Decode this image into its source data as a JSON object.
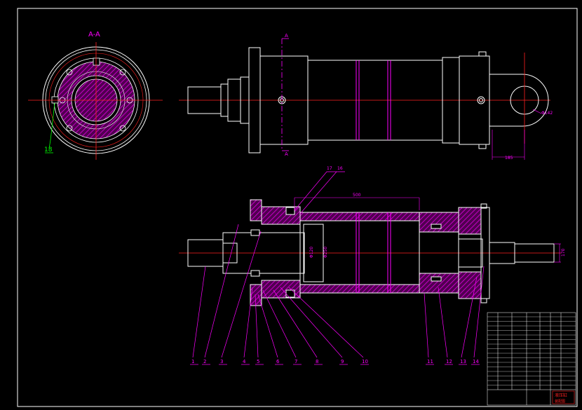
{
  "section": {
    "title": "A-A",
    "cut_mark_top": "A",
    "cut_mark_bottom": "A"
  },
  "dimensions": {
    "eye_diameter": "Φ142",
    "eye_offset": "185",
    "stroke": "500",
    "bore": "Φ250",
    "rod": "Φ120",
    "rod_end": "170"
  },
  "part_numbers": [
    "1",
    "2",
    "3",
    "4",
    "5",
    "6",
    "7",
    "8",
    "9",
    "10",
    "11",
    "12",
    "13",
    "14"
  ],
  "top_callouts": [
    "17",
    "16"
  ],
  "section_callout": "18",
  "title_block": {
    "name": "液压缸",
    "subtitle": "装配图"
  },
  "colors": {
    "outline": "#ffffff",
    "centerline": "#ff2020",
    "annotation": "#ff00ff",
    "hatch": "#c000c0",
    "leader": "#00ff00",
    "background": "#000000"
  }
}
